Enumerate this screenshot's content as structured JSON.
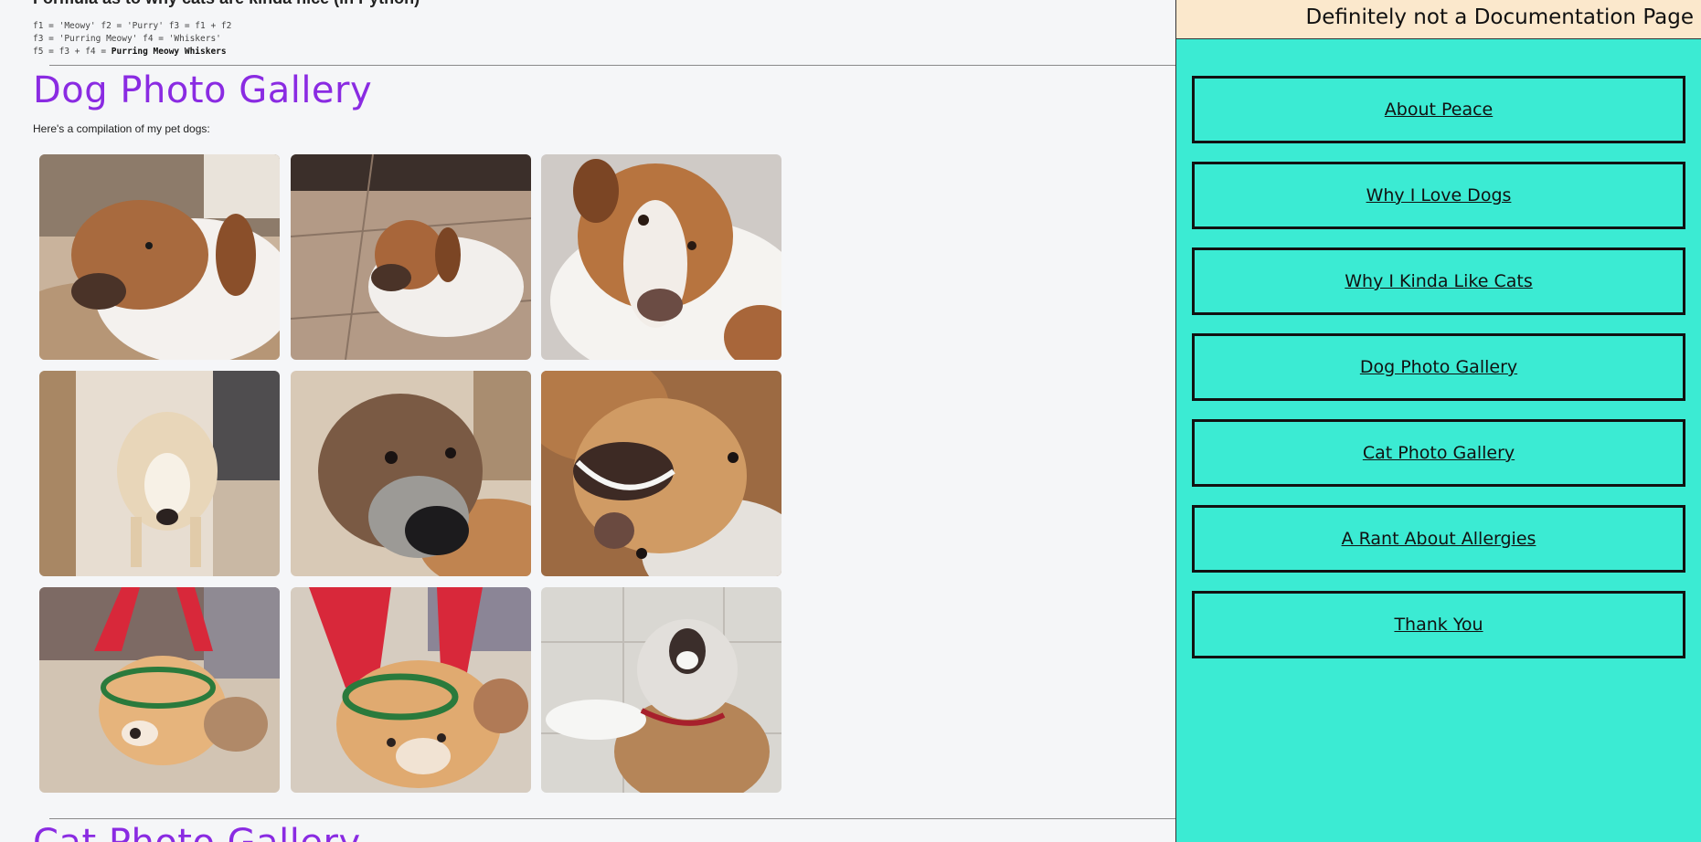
{
  "main": {
    "top_heading": "Formula as to why cats are kinda nice (in Python)",
    "code": {
      "line1": "f1 = 'Meowy' f2 = 'Purry' f3 = f1 + f2",
      "line2": "f3 = 'Purring Meowy' f4 = 'Whiskers'",
      "line3_prefix": "f5 = f3 + f4 = ",
      "line3_result": "Purring Meowy Whiskers"
    },
    "dog_gallery": {
      "title": "Dog Photo Gallery",
      "intro": "Here's a compilation of my pet dogs:",
      "photos": [
        {
          "alt": "brown and white dog lying on tile floor"
        },
        {
          "alt": "brown and white dog lying on floor tiles"
        },
        {
          "alt": "dog with head tilted"
        },
        {
          "alt": "cream dog standing by a door"
        },
        {
          "alt": "black-muzzled dog close-up"
        },
        {
          "alt": "dog upside down showing teeth"
        },
        {
          "alt": "dog wearing red reindeer antlers"
        },
        {
          "alt": "dog wearing red reindeer antlers being petted"
        },
        {
          "alt": "dog lying on floor with mouth open"
        }
      ]
    },
    "cat_gallery": {
      "title": "Cat Photo Gallery"
    }
  },
  "sidebar": {
    "title": "Definitely not a Documentation Page",
    "links": [
      {
        "label": "About Peace"
      },
      {
        "label": "Why I Love Dogs"
      },
      {
        "label": "Why I Kinda Like Cats"
      },
      {
        "label": "Dog Photo Gallery"
      },
      {
        "label": "Cat Photo Gallery"
      },
      {
        "label": "A Rant About Allergies"
      },
      {
        "label": "Thank You"
      }
    ]
  },
  "colors": {
    "sidebar_bg": "#3bebd3",
    "sidebar_header_bg": "#fbe8cc",
    "section_title": "#8a2be2",
    "page_bg": "#f5f6f8"
  }
}
